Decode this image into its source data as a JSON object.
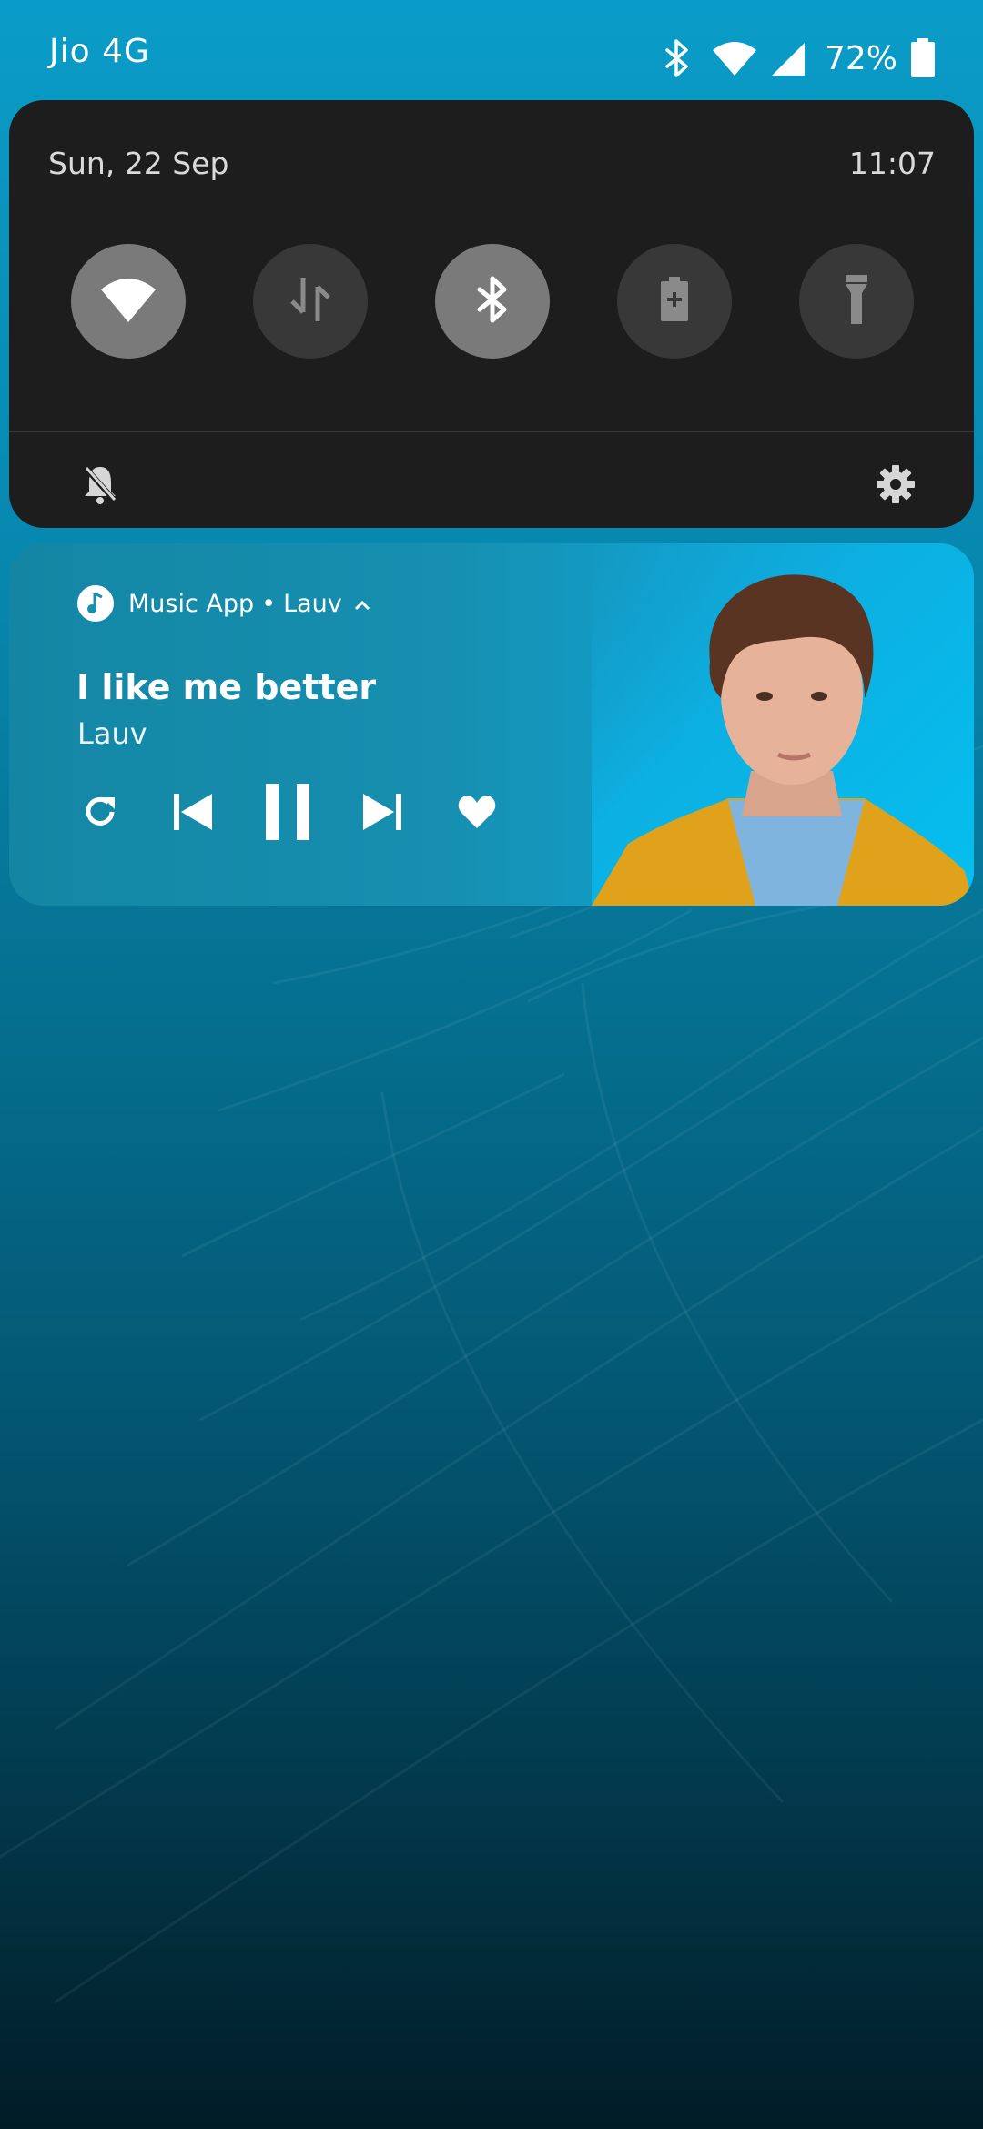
{
  "status_bar": {
    "carrier": "Jio 4G",
    "battery_percent": "72%",
    "battery_level": 0.72,
    "icons": [
      "bluetooth-icon",
      "wifi-icon",
      "cell-signal-icon",
      "battery-icon"
    ]
  },
  "quick_settings": {
    "date": "Sun, 22 Sep",
    "time": "11:07",
    "tiles": [
      {
        "name": "wifi",
        "icon": "wifi-icon",
        "state": "on"
      },
      {
        "name": "mobile-data",
        "icon": "data-arrows-icon",
        "state": "off"
      },
      {
        "name": "bluetooth",
        "icon": "bluetooth-icon",
        "state": "on"
      },
      {
        "name": "battery-saver",
        "icon": "battery-saver-icon",
        "state": "off"
      },
      {
        "name": "flashlight",
        "icon": "flashlight-icon",
        "state": "off"
      }
    ],
    "footer_icons": [
      "bell-off-icon",
      "gear-icon"
    ]
  },
  "media": {
    "app_name": "Music App",
    "separator": "•",
    "header_artist": "Lauv",
    "title": "I like me better",
    "artist": "Lauv",
    "controls": [
      "repeat-icon",
      "skip-previous-icon",
      "pause-icon",
      "skip-next-icon",
      "heart-icon"
    ],
    "colors": {
      "card_left": "#1486a4",
      "card_right": "#0bb3e6",
      "jacket": "#e0a21b"
    }
  }
}
